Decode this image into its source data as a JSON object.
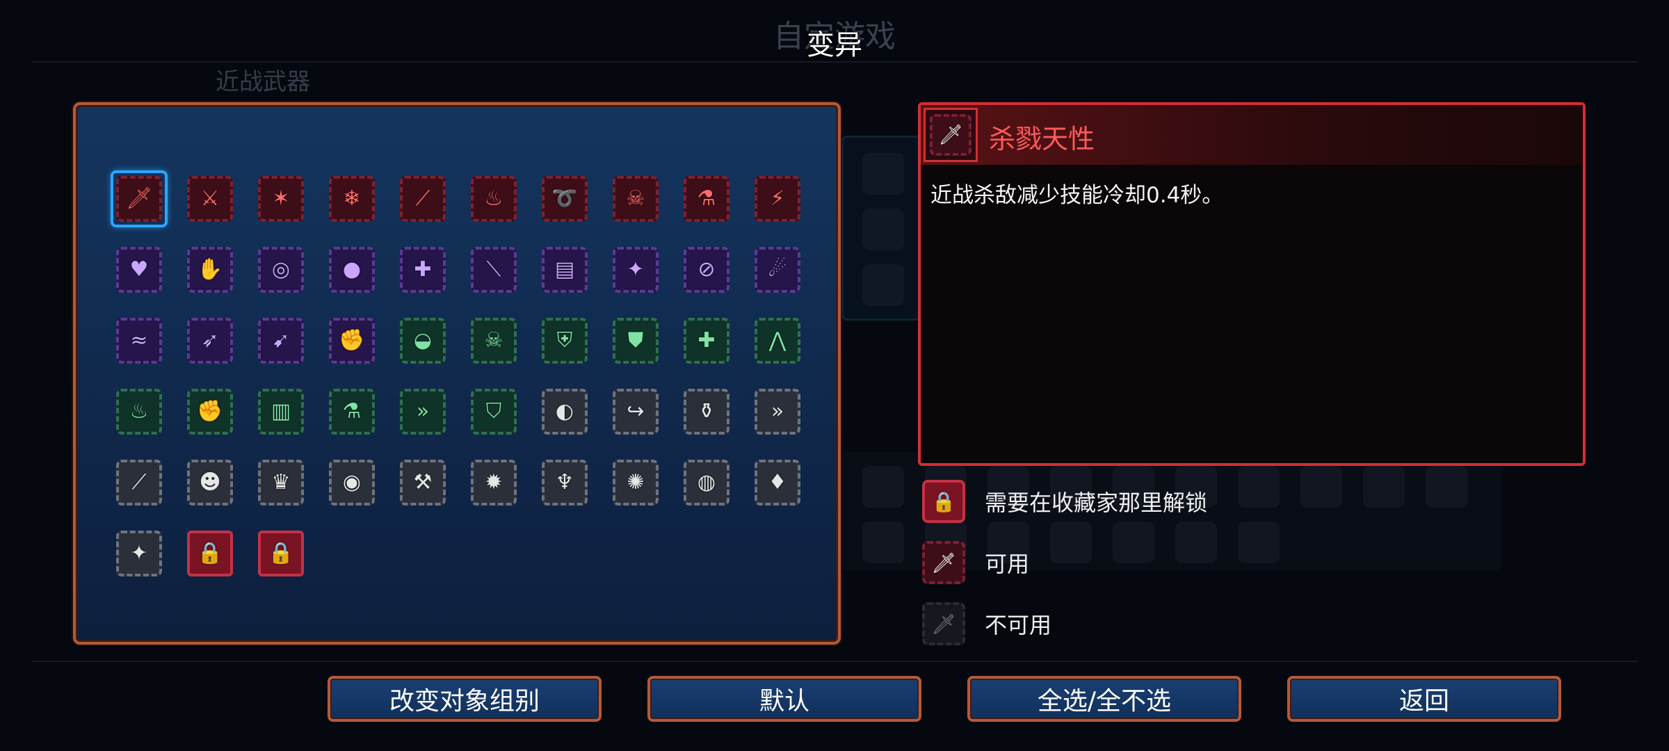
{
  "background": {
    "title": "自定游戏",
    "subtitle": "近战武器"
  },
  "dialog": {
    "title": "变异"
  },
  "mutations": [
    {
      "icon": "sword-icon",
      "glyph": "🗡",
      "frame": "red",
      "selected": true
    },
    {
      "icon": "crossbow-icon",
      "glyph": "⚔",
      "frame": "red"
    },
    {
      "icon": "claw-icon",
      "glyph": "✶",
      "frame": "red"
    },
    {
      "icon": "scythe-ice-icon",
      "glyph": "❄",
      "frame": "red"
    },
    {
      "icon": "slash-icon",
      "glyph": "⟋",
      "frame": "red"
    },
    {
      "icon": "potion-bag-icon",
      "glyph": "♨",
      "frame": "red"
    },
    {
      "icon": "whip-icon",
      "glyph": "➰",
      "frame": "red"
    },
    {
      "icon": "skull-ring-icon",
      "glyph": "☠",
      "frame": "red"
    },
    {
      "icon": "blue-flask-icon",
      "glyph": "⚗",
      "frame": "red"
    },
    {
      "icon": "lightning-icon",
      "glyph": "⚡",
      "frame": "red"
    },
    {
      "icon": "heart-gem-icon",
      "glyph": "♥",
      "frame": "purple"
    },
    {
      "icon": "grab-icon",
      "glyph": "✋",
      "frame": "purple"
    },
    {
      "icon": "ring-icon",
      "glyph": "◎",
      "frame": "purple"
    },
    {
      "icon": "bomb-icon",
      "glyph": "●",
      "frame": "purple"
    },
    {
      "icon": "target-icon",
      "glyph": "✚",
      "frame": "purple"
    },
    {
      "icon": "blades-icon",
      "glyph": "⟍",
      "frame": "purple"
    },
    {
      "icon": "scroll-icon",
      "glyph": "▤",
      "frame": "purple"
    },
    {
      "icon": "shuriken-icon",
      "glyph": "✦",
      "frame": "purple"
    },
    {
      "icon": "no-entry-icon",
      "glyph": "⊘",
      "frame": "purple"
    },
    {
      "icon": "bone-icon",
      "glyph": "☄",
      "frame": "purple"
    },
    {
      "icon": "wind-icon",
      "glyph": "≈",
      "frame": "purple"
    },
    {
      "icon": "frost-arrow-icon",
      "glyph": "➶",
      "frame": "purple"
    },
    {
      "icon": "bow-icon",
      "glyph": "➹",
      "frame": "purple"
    },
    {
      "icon": "gauntlet-arrow-icon",
      "glyph": "✊",
      "frame": "purple"
    },
    {
      "icon": "egg-potion-icon",
      "glyph": "◒",
      "frame": "green"
    },
    {
      "icon": "skull-crossbones-icon",
      "glyph": "☠",
      "frame": "green"
    },
    {
      "icon": "blue-shield-icon",
      "glyph": "⛨",
      "frame": "green"
    },
    {
      "icon": "gold-shield-icon",
      "glyph": "⛊",
      "frame": "green"
    },
    {
      "icon": "green-cross-icon",
      "glyph": "✚",
      "frame": "green"
    },
    {
      "icon": "fangs-icon",
      "glyph": "⋀",
      "frame": "green"
    },
    {
      "icon": "torch-icon",
      "glyph": "♨",
      "frame": "green"
    },
    {
      "icon": "fist-icon",
      "glyph": "✊",
      "frame": "green"
    },
    {
      "icon": "blue-armor-icon",
      "glyph": "▥",
      "frame": "green"
    },
    {
      "icon": "red-potion-icon",
      "glyph": "⚗",
      "frame": "green"
    },
    {
      "icon": "double-arrow-icon",
      "glyph": "»",
      "frame": "green"
    },
    {
      "icon": "shield-gauntlet-icon",
      "glyph": "⛉",
      "frame": "green"
    },
    {
      "icon": "meat-icon",
      "glyph": "◐",
      "frame": "gray"
    },
    {
      "icon": "dash-icon",
      "glyph": "↪",
      "frame": "gray"
    },
    {
      "icon": "orange-flask-icon",
      "glyph": "⚱",
      "frame": "gray"
    },
    {
      "icon": "gold-arrows-icon",
      "glyph": "»",
      "frame": "gray"
    },
    {
      "icon": "leaf-dagger-icon",
      "glyph": "⟋",
      "frame": "gray"
    },
    {
      "icon": "zombie-skull-icon",
      "glyph": "☻",
      "frame": "gray"
    },
    {
      "icon": "crown-icon",
      "glyph": "♛",
      "frame": "gray"
    },
    {
      "icon": "pink-orb-icon",
      "glyph": "◉",
      "frame": "gray"
    },
    {
      "icon": "hammer-icon",
      "glyph": "⚒",
      "frame": "gray"
    },
    {
      "icon": "sun-burst-icon",
      "glyph": "✹",
      "frame": "gray"
    },
    {
      "icon": "drumstick-icon",
      "glyph": "♆",
      "frame": "gray"
    },
    {
      "icon": "gold-flame-icon",
      "glyph": "✺",
      "frame": "gray"
    },
    {
      "icon": "gold-coin-icon",
      "glyph": "◍",
      "frame": "gray"
    },
    {
      "icon": "red-crystal-icon",
      "glyph": "♦",
      "frame": "gray"
    },
    {
      "icon": "star-spark-icon",
      "glyph": "✦",
      "frame": "gray"
    },
    {
      "icon": "lock-icon",
      "glyph": "🔒",
      "frame": "lock"
    },
    {
      "icon": "lock-icon",
      "glyph": "🔒",
      "frame": "lock"
    }
  ],
  "details": {
    "name": "杀戮天性",
    "description": "近战杀敌减少技能冷却0.4秒。"
  },
  "legend": [
    {
      "icon": "lock-icon",
      "label": "需要在收藏家那里解锁"
    },
    {
      "icon": "sword-icon",
      "label": "可用"
    },
    {
      "icon": "sword-disabled-icon",
      "label": "不可用"
    }
  ],
  "buttons": {
    "change_group": "改变对象组别",
    "default": "默认",
    "toggle_all": "全选/全不选",
    "back": "返回"
  },
  "colors": {
    "accent_red": "#d62d35",
    "selection_blue": "#2aa6ff",
    "panel_border": "#b25a3c"
  }
}
